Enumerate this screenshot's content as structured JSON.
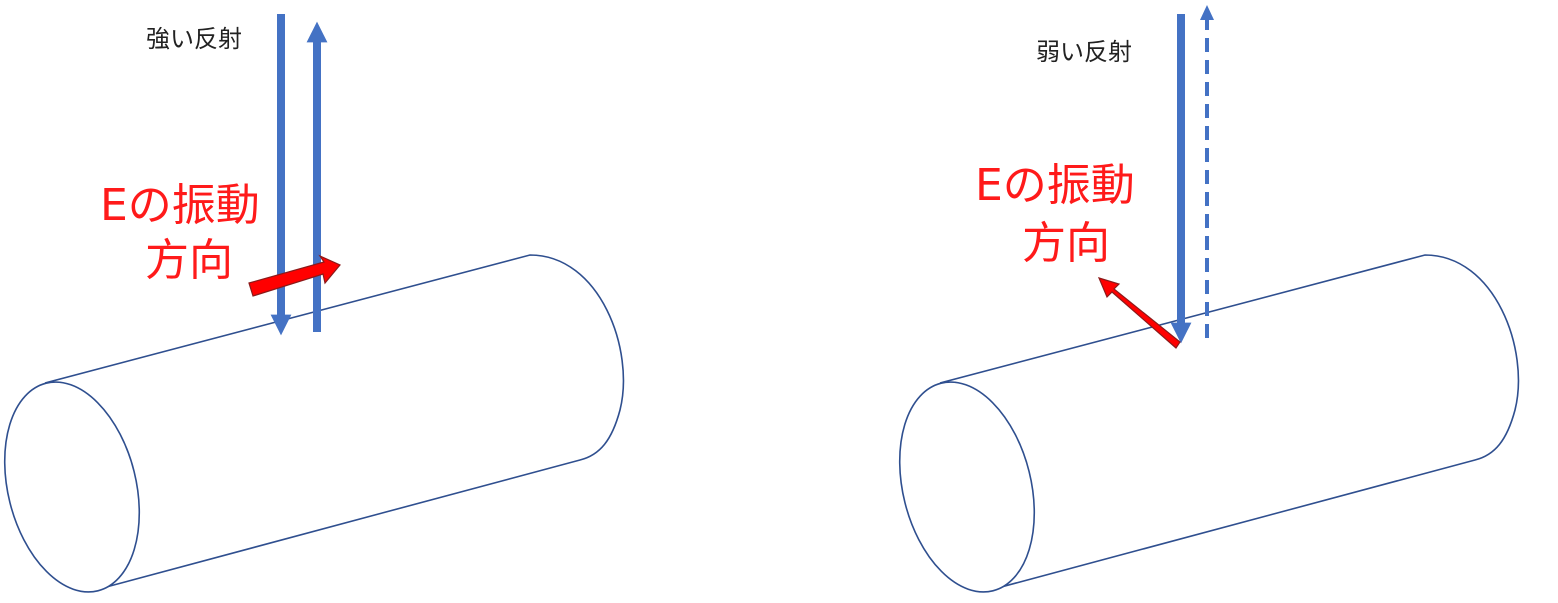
{
  "left_panel": {
    "reflection_label": "強い反射",
    "e_label_line1": "Eの振動",
    "e_label_line2": "方向"
  },
  "right_panel": {
    "reflection_label": "弱い反射",
    "e_label_line1": "Eの振動",
    "e_label_line2": "方向"
  },
  "colors": {
    "beam": "#4472c4",
    "e_field": "#ff0000",
    "outline": "#2f4f8f",
    "label_red": "#ff1a1a",
    "label_black": "#222222"
  }
}
